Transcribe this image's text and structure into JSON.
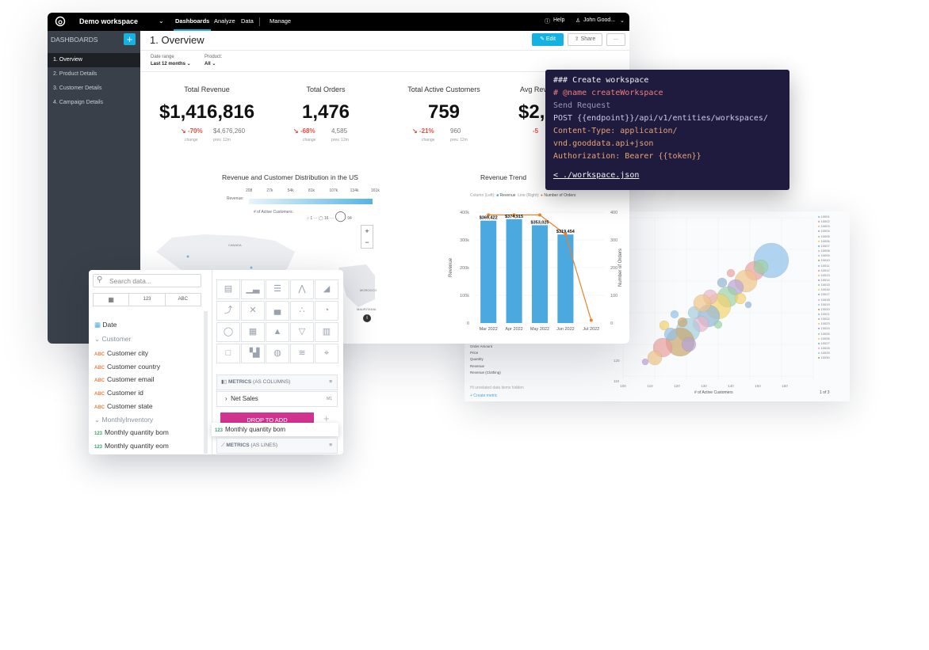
{
  "topbar": {
    "workspace": "Demo workspace",
    "nav": [
      "Dashboards",
      "Analyze",
      "Data",
      "Manage"
    ],
    "help": "Help",
    "user": "John Good..."
  },
  "sidebar": {
    "header": "DASHBOARDS",
    "items": [
      "1. Overview",
      "2. Product Details",
      "3. Customer Details",
      "4. Campaign Details"
    ]
  },
  "dashboard": {
    "title": "1. Overview",
    "edit": "Edit",
    "share": "Share",
    "more": "...",
    "filters": [
      {
        "label": "Date range",
        "value": "Last 12 months"
      },
      {
        "label": "Product:",
        "value": "All"
      }
    ],
    "kpis": [
      {
        "title": "Total Revenue",
        "value": "$1,416,816",
        "change": "-70%",
        "change_label": "change",
        "prev": "$4,676,260",
        "prev_label": "prev. 12m"
      },
      {
        "title": "Total Orders",
        "value": "1,476",
        "change": "-68%",
        "change_label": "change",
        "prev": "4,585",
        "prev_label": "prev. 12m"
      },
      {
        "title": "Total Active Customers",
        "value": "759",
        "change": "-21%",
        "change_label": "change",
        "prev": "960",
        "prev_label": "prev. 12m"
      },
      {
        "title": "Avg Rev",
        "value": "$2,",
        "change": "-5",
        "change_label": "",
        "prev": "",
        "prev_label": ""
      }
    ],
    "map": {
      "title": "Revenue and Customer Distribution in the US",
      "revenue_label": "Revenue:",
      "revenue_ticks": [
        "208",
        "27k",
        "54k",
        "81k",
        "107k",
        "134k",
        "161k"
      ],
      "customers_label": "# of Active Customers:",
      "customers_ticks": [
        "1",
        "16",
        "94"
      ],
      "places": [
        "CANADA",
        "MOROCCO",
        "MAURITANIA"
      ],
      "zoom_in": "+",
      "zoom_out": "−"
    }
  },
  "chart_data": {
    "type": "bar",
    "title": "Revenue Trend",
    "legend": {
      "column_label": "Column (Left):",
      "line_label": "Line (Right):",
      "placement": "top-right"
    },
    "categories": [
      "Mar 2022",
      "Apr 2022",
      "May 2022",
      "Jun 2022",
      "Jul 2022"
    ],
    "series": [
      {
        "name": "Revenue",
        "type": "bar",
        "axis": "left",
        "values": [
          369422,
          374915,
          353025,
          319454,
          0
        ],
        "labels": [
          "$369,422",
          "$374,915",
          "$353,025",
          "$319,454",
          ""
        ]
      },
      {
        "name": "Number of Orders",
        "type": "line",
        "axis": "right",
        "values": [
          390,
          390,
          390,
          320,
          10
        ]
      }
    ],
    "ylabel": "Revenue",
    "y2label": "Number of Orders",
    "ylim": [
      0,
      400000
    ],
    "y2lim": [
      0,
      400
    ],
    "yticks": [
      "0",
      "100k",
      "200k",
      "300k",
      "400k"
    ],
    "y2ticks": [
      "0",
      "100",
      "200",
      "300",
      "400"
    ],
    "colors": {
      "bar": "#4ba9e0",
      "line": "#e8822e"
    }
  },
  "code": {
    "lines": [
      "### Create workspace",
      "# @name createWorkspace",
      "Send Request",
      "POST {{endpoint}}/api/v1/entities/workspaces/",
      "Content-Type: application/",
      "vnd.gooddata.api+json",
      "Authorization: Bearer {{token}}",
      "",
      "< ./workspace.json"
    ]
  },
  "bubble": {
    "xlabel": "# of Active Customers",
    "xticks": [
      "100",
      "110",
      "120",
      "130",
      "140",
      "150",
      "160"
    ],
    "yticks": [
      "120",
      "110"
    ],
    "legend": [
      "10001",
      "10002",
      "10003",
      "10004",
      "10005",
      "10006",
      "10007",
      "10008",
      "10009",
      "10010",
      "10011",
      "10012",
      "10013",
      "10014",
      "10015",
      "10016",
      "10017",
      "10018",
      "10019",
      "10020",
      "10021",
      "10022",
      "10023",
      "10024",
      "10025",
      "10026",
      "10027",
      "10028",
      "10029",
      "10030"
    ],
    "pager": "1 of 3",
    "fields": [
      "Order Amount",
      "Price",
      "Quantity",
      "Revenue",
      "Revenue (Clothing)"
    ],
    "unrelated": "Hi unrelated data items hidden",
    "create_metric": "+ Create metric"
  },
  "designer": {
    "search_placeholder": "Search data...",
    "filter_tabs": [
      "123",
      "ABC"
    ],
    "date": "Date",
    "group1": "Customer",
    "fields1": [
      "Customer city",
      "Customer country",
      "Customer email",
      "Customer id",
      "Customer state"
    ],
    "group2": "MonthlyInventory",
    "fields2": [
      "Monthly quantity bom",
      "Monthly quantity eom"
    ],
    "abc": "ABC",
    "num": "123",
    "metrics_columns": "METRICS",
    "metrics_columns_suffix": "(AS COLUMNS)",
    "net_sales": "Net Sales",
    "net_sales_code": "M1",
    "drop": "DROP TO ADD",
    "dragging": "Monthly quantity bom",
    "metrics_lines": "METRICS",
    "metrics_lines_suffix": "(AS LINES)"
  }
}
